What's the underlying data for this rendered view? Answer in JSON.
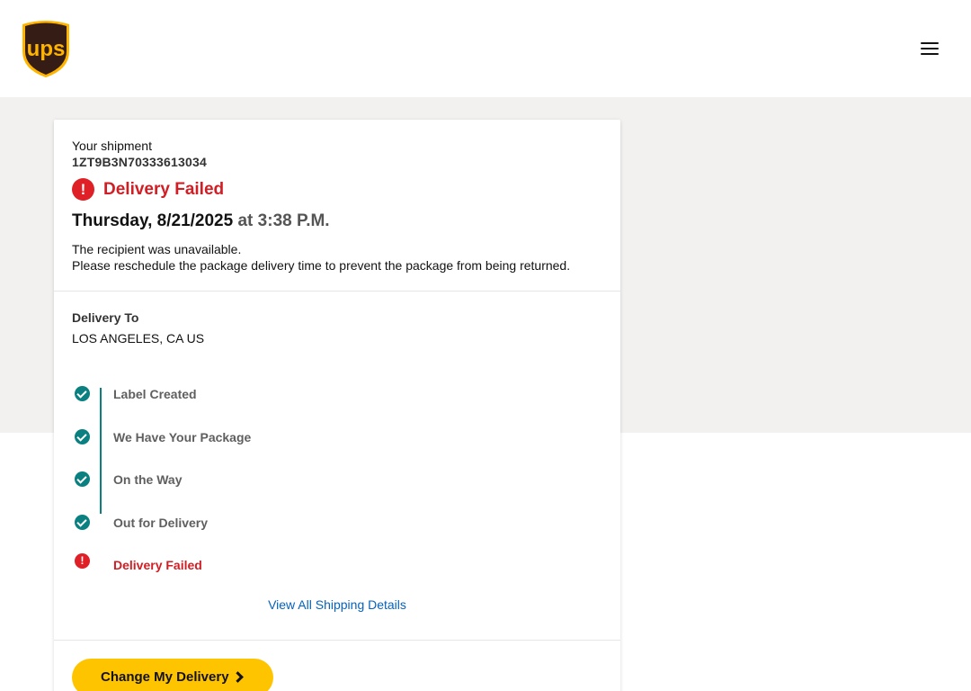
{
  "header": {
    "logo_text": "ups",
    "menu_icon": "hamburger-menu-icon"
  },
  "shipment": {
    "label": "Your shipment",
    "tracking_number": "1ZT9B3N70333613034",
    "status_icon": "alert-circle-icon",
    "status": "Delivery Failed",
    "date": "Thursday, 8/21/2025",
    "at_word": "at",
    "time": "3:38 P.M.",
    "message_line1": "The recipient was unavailable.",
    "message_line2": "Please reschedule the package delivery time to prevent the package from being returned."
  },
  "delivery_to": {
    "label": "Delivery To",
    "value": "LOS ANGELES, CA US"
  },
  "timeline": [
    {
      "label": "Label Created",
      "state": "done"
    },
    {
      "label": "We Have Your Package",
      "state": "done"
    },
    {
      "label": "On the Way",
      "state": "done"
    },
    {
      "label": "Out for Delivery",
      "state": "done"
    },
    {
      "label": "Delivery Failed",
      "state": "failed"
    }
  ],
  "links": {
    "view_details": "View All Shipping Details"
  },
  "cta": {
    "label": "Change My Delivery",
    "icon": "chevron-right-icon"
  },
  "colors": {
    "brand_brown": "#351c15",
    "brand_gold": "#ffb500",
    "alert_red": "#df2027",
    "teal": "#0a8080",
    "link_blue": "#0662bb",
    "cta_yellow": "#ffc400",
    "background_grey": "#f2f1ef"
  }
}
